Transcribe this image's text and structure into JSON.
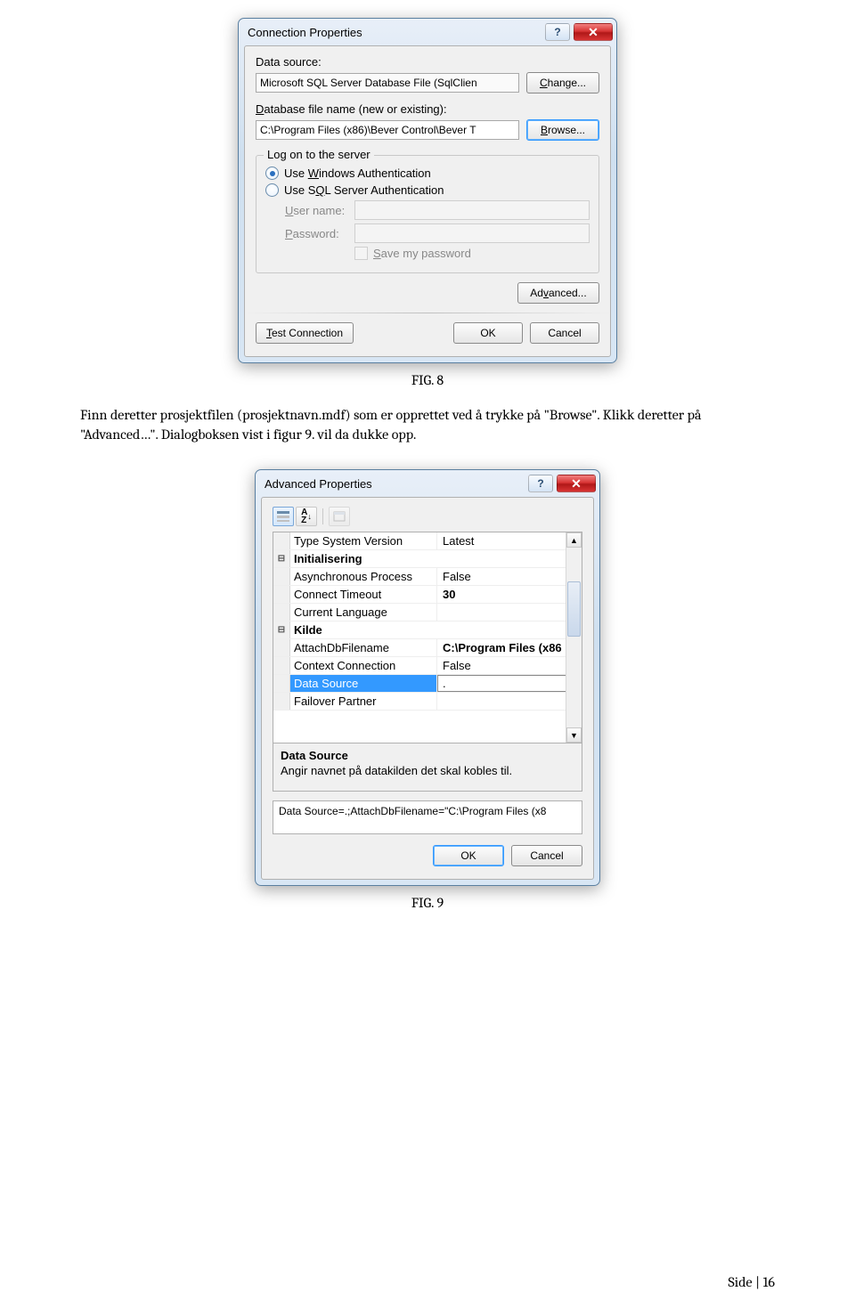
{
  "figure1": {
    "dialog_title": "Connection Properties",
    "data_source_label": "Data source:",
    "data_source_value": "Microsoft SQL Server Database File (SqlClien",
    "change_label": "Change...",
    "db_file_label": "Database file name (new or existing):",
    "db_file_value": "C:\\Program Files (x86)\\Bever Control\\Bever T",
    "browse_label": "Browse...",
    "logon_group": "Log on to the server",
    "use_windows_auth": "Use Windows Authentication",
    "use_sql_auth": "Use SQL Server Authentication",
    "user_label": "User name:",
    "pass_label": "Password:",
    "save_pw": "Save my password",
    "advanced_label": "Advanced...",
    "test_label": "Test Connection",
    "ok_label": "OK",
    "cancel_label": "Cancel"
  },
  "fig1_caption": "FIG. 8",
  "body_para": "Finn deretter prosjektfilen (prosjektnavn.mdf) som er opprettet ved å trykke på \"Browse\". Klikk deretter på \"Advanced…\". Dialogboksen vist i figur 9. vil da dukke opp.",
  "figure2": {
    "dialog_title": "Advanced Properties",
    "rows": [
      {
        "type": "item",
        "name": "Type System Version",
        "value": "Latest"
      },
      {
        "type": "cat",
        "name": "Initialisering"
      },
      {
        "type": "item",
        "name": "Asynchronous Process",
        "value": "False"
      },
      {
        "type": "item",
        "name": "Connect Timeout",
        "value": "30",
        "bold": true
      },
      {
        "type": "item",
        "name": "Current Language",
        "value": ""
      },
      {
        "type": "cat",
        "name": "Kilde"
      },
      {
        "type": "item",
        "name": "AttachDbFilename",
        "value": "C:\\Program Files (x86",
        "bold": true
      },
      {
        "type": "item",
        "name": "Context Connection",
        "value": "False"
      },
      {
        "type": "sel",
        "name": "Data Source",
        "value": "."
      },
      {
        "type": "item",
        "name": "Failover Partner",
        "value": ""
      }
    ],
    "desc_title": "Data Source",
    "desc_text": "Angir navnet på datakilden det skal kobles til.",
    "connstr": "Data Source=.;AttachDbFilename=\"C:\\Program Files (x8",
    "ok_label": "OK",
    "cancel_label": "Cancel"
  },
  "fig2_caption": "FIG. 9",
  "page_footer": "Side | 16"
}
